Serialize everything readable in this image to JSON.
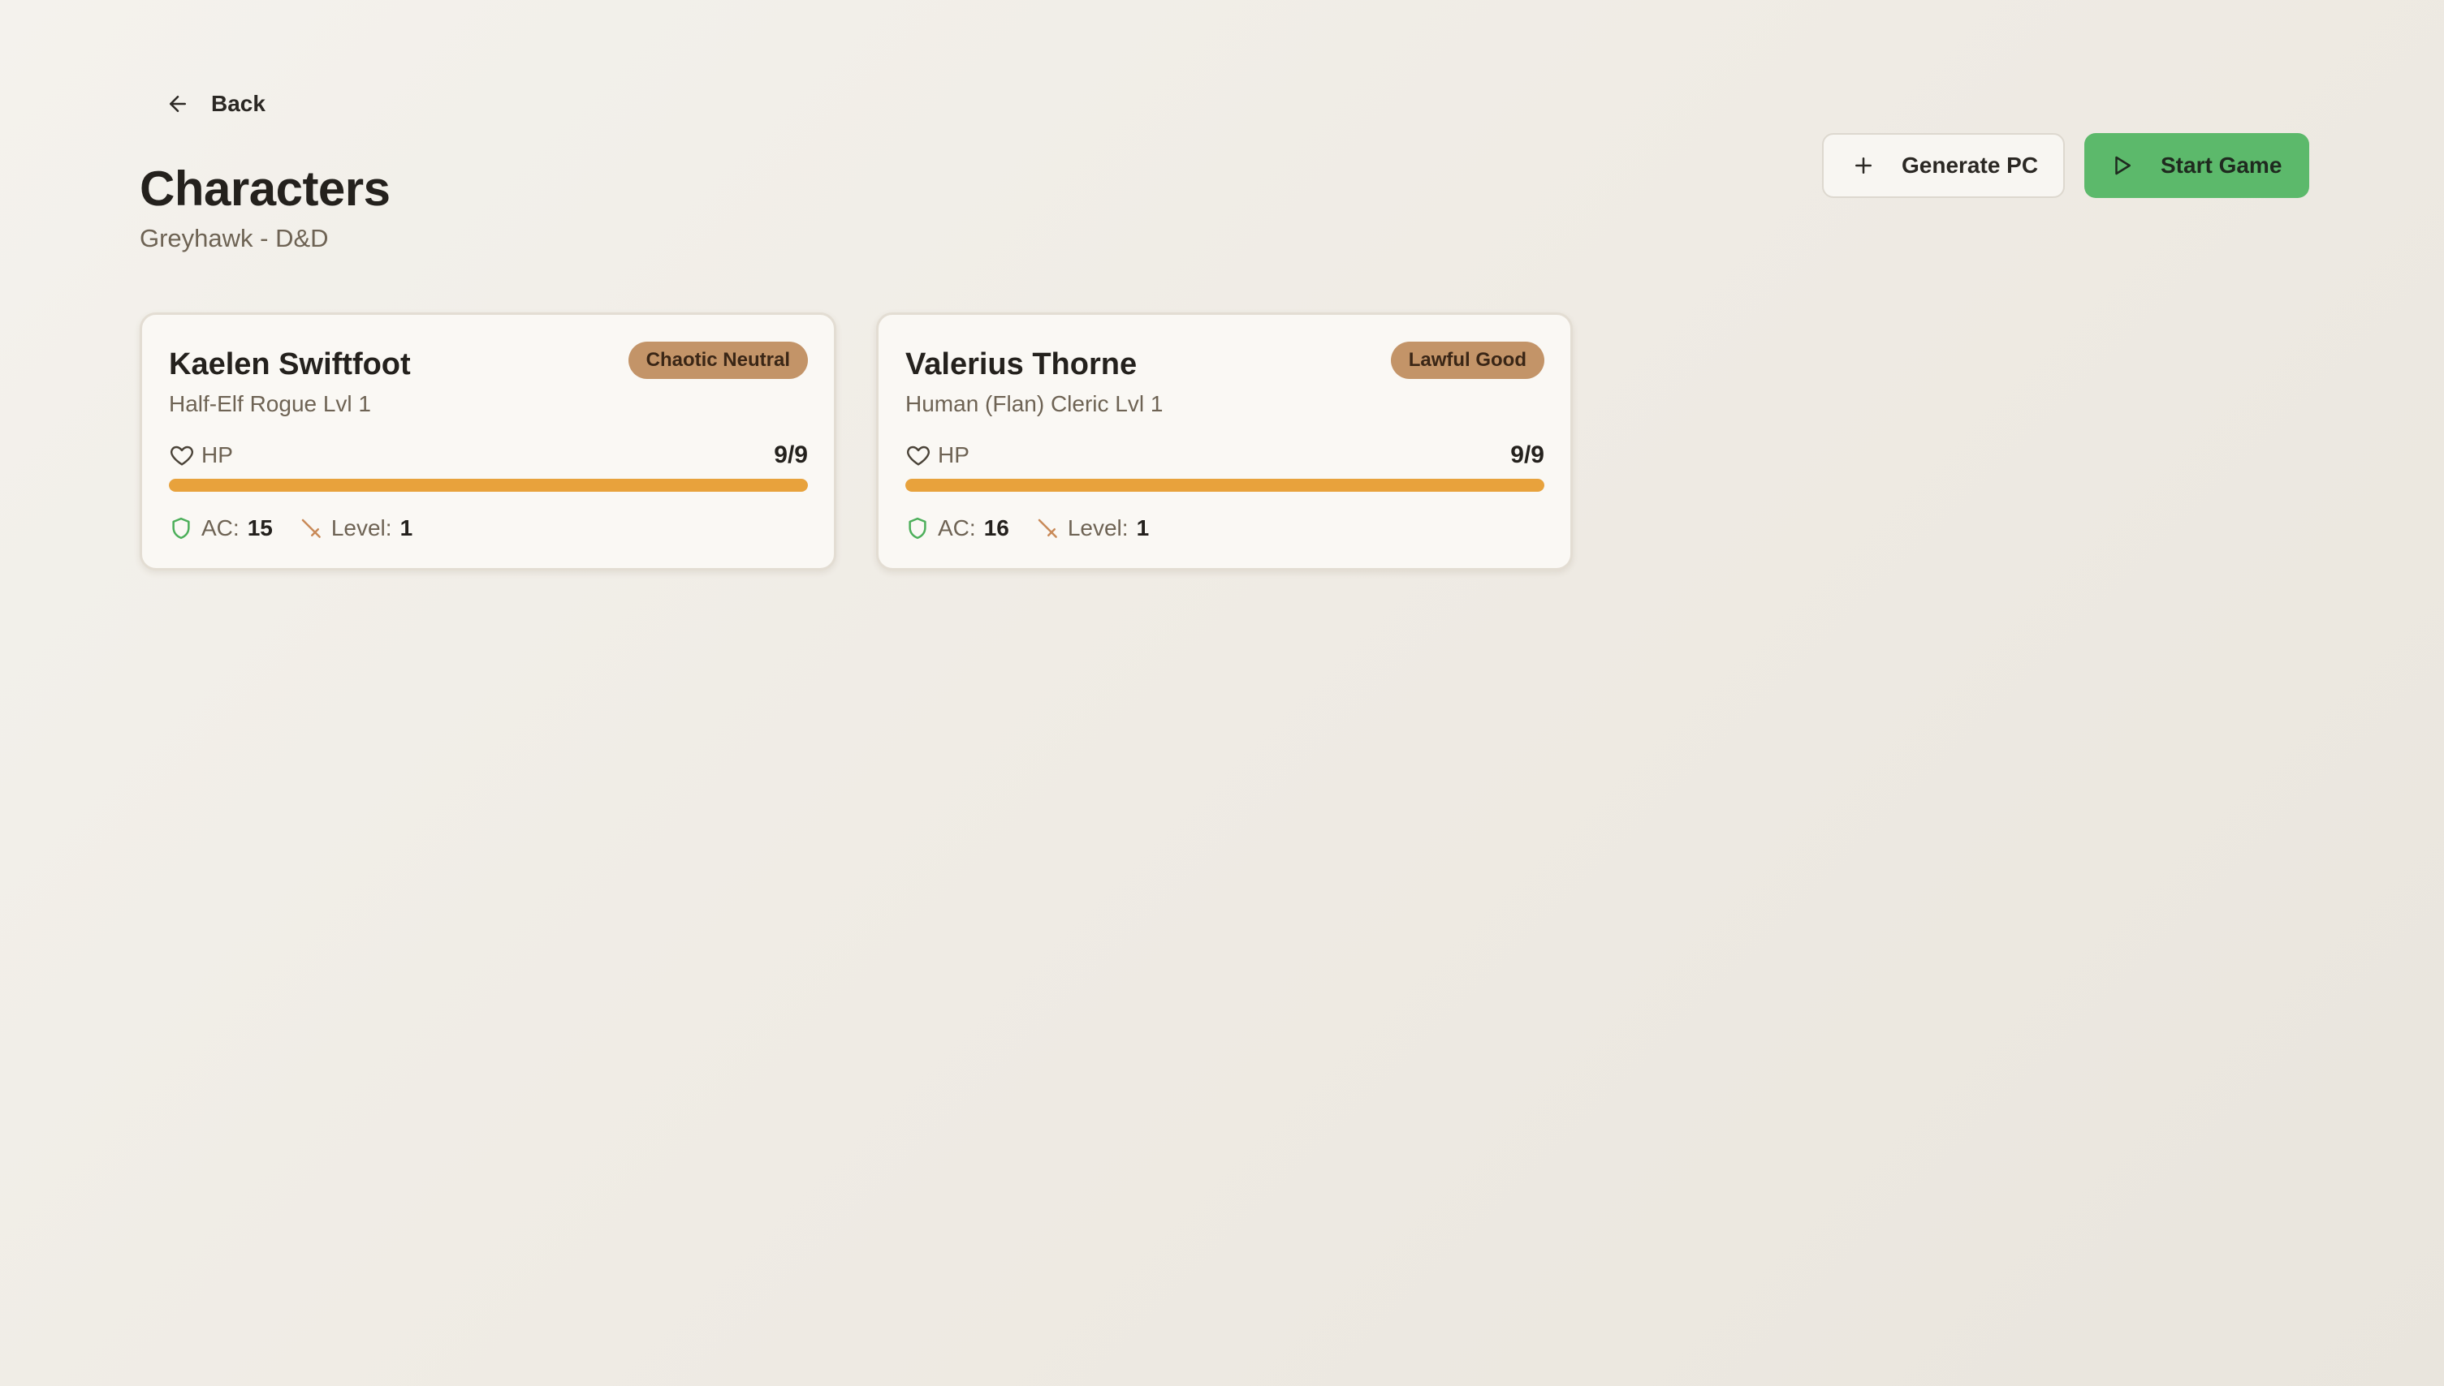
{
  "nav": {
    "back_label": "Back",
    "back_icon": "arrow-left-icon"
  },
  "header": {
    "title": "Characters",
    "subtitle": "Greyhawk - D&D"
  },
  "actions": {
    "generate_label": "Generate PC",
    "generate_icon": "plus-icon",
    "start_label": "Start Game",
    "start_icon": "play-icon"
  },
  "colors": {
    "accent_green": "#5cb96b",
    "hp_bar": "#e8a23c",
    "badge": "#c39468",
    "shield": "#4caf5a",
    "sword": "#c98a58"
  },
  "characters": [
    {
      "name": "Kaelen Swiftfoot",
      "alignment": "Chaotic Neutral",
      "description": "Half-Elf Rogue Lvl 1",
      "hp_label": "HP",
      "hp_text": "9/9",
      "hp_fraction": 1.0,
      "ac_label": "AC:",
      "ac_value": "15",
      "level_label": "Level:",
      "level_value": "1"
    },
    {
      "name": "Valerius Thorne",
      "alignment": "Lawful Good",
      "description": "Human (Flan) Cleric Lvl 1",
      "hp_label": "HP",
      "hp_text": "9/9",
      "hp_fraction": 1.0,
      "ac_label": "AC:",
      "ac_value": "16",
      "level_label": "Level:",
      "level_value": "1"
    }
  ]
}
